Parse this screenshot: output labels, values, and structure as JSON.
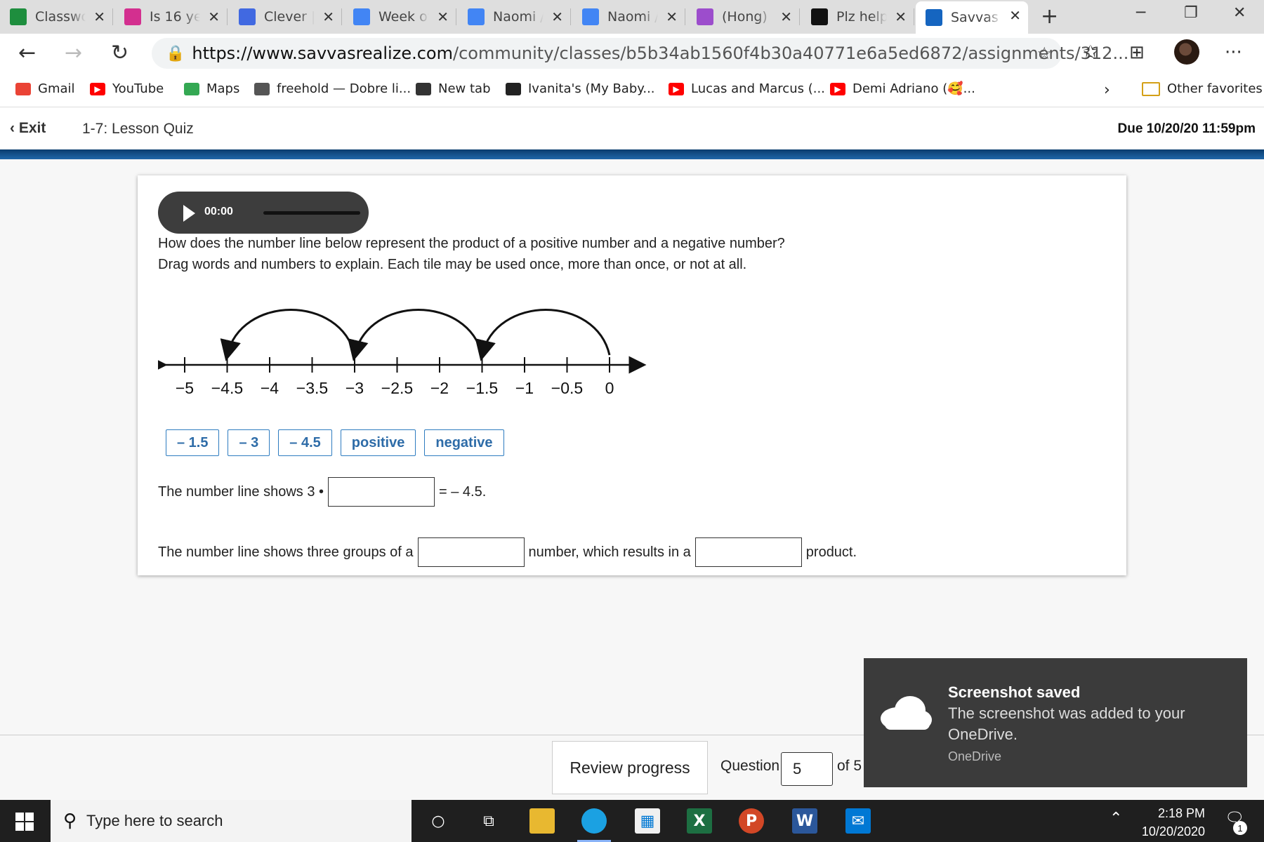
{
  "browser": {
    "tabs": [
      {
        "label": "Classwo",
        "icon": "google-classroom-icon",
        "color": "#1e8e3e"
      },
      {
        "label": "Is 16 ye",
        "icon": "colorful-logo-icon",
        "color": "#d32f8f"
      },
      {
        "label": "Clever |",
        "icon": "clever-icon",
        "color": "#4169e1"
      },
      {
        "label": "Week of",
        "icon": "google-docs-icon",
        "color": "#4285f4"
      },
      {
        "label": "Naomi /",
        "icon": "google-docs-icon",
        "color": "#4285f4"
      },
      {
        "label": "Naomi /",
        "icon": "google-docs-icon",
        "color": "#4285f4"
      },
      {
        "label": "(Hong)",
        "icon": "purple-contact-icon",
        "color": "#9c4dcc"
      },
      {
        "label": "Plz help",
        "icon": "brainly-icon",
        "color": "#111111"
      },
      {
        "label": "Savvas R",
        "icon": "savvas-icon",
        "color": "#1565c0",
        "active": true
      }
    ],
    "url_host": "https://www.savvasrealize.com",
    "url_path": "/community/classes/b5b34ab1560f4b30a40771e6a5ed6872/assignments/312...",
    "bookmarks": [
      {
        "label": "Gmail",
        "icon": "gmail-icon"
      },
      {
        "label": "YouTube",
        "icon": "youtube-icon"
      },
      {
        "label": "Maps",
        "icon": "maps-icon"
      },
      {
        "label": "freehold — Dobre li...",
        "icon": "cube-icon"
      },
      {
        "label": "New tab",
        "icon": "newtab-icon"
      },
      {
        "label": "Ivanita's (My Baby...",
        "icon": "f-icon"
      },
      {
        "label": "Lucas and Marcus (...",
        "icon": "youtube-icon"
      },
      {
        "label": "Demi Adriano (🥰...",
        "icon": "youtube-icon"
      }
    ],
    "other_favorites": "Other favorites"
  },
  "header": {
    "exit_label": "Exit",
    "lesson_title": "1-7: Lesson Quiz",
    "due": "Due 10/20/20 11:59pm"
  },
  "question": {
    "audio_time": "00:00",
    "prompt_line1": "How does the number line below represent the product of a positive number and a negative number?",
    "prompt_line2": "Drag words and numbers to explain. Each tile may be used once, more than once, or not at all.",
    "number_line": {
      "ticks": [
        "−5",
        "−4.5",
        "−4",
        "−3.5",
        "−3",
        "−2.5",
        "−2",
        "−1.5",
        "−1",
        "−0.5",
        "0"
      ],
      "jumps": [
        [
          0,
          -1.5
        ],
        [
          -1.5,
          -3
        ],
        [
          -3,
          -4.5
        ]
      ]
    },
    "tiles": [
      "– 1.5",
      "– 3",
      "– 4.5",
      "positive",
      "negative"
    ],
    "sentence1_before": "The number line shows 3 •",
    "sentence1_after": "= – 4.5.",
    "sentence2_part1": "The number line shows three groups of a",
    "sentence2_part2": "number, which results in a",
    "sentence2_part3": "product."
  },
  "footer": {
    "review_label": "Review progress",
    "question_label": "Question",
    "question_value": "5",
    "of_total": "of 5"
  },
  "toast": {
    "title": "Screenshot saved",
    "body": "The screenshot was added to your OneDrive.",
    "source": "OneDrive"
  },
  "taskbar": {
    "search_placeholder": "Type here to search",
    "time": "2:18 PM",
    "date": "10/20/2020",
    "notification_count": "1"
  }
}
